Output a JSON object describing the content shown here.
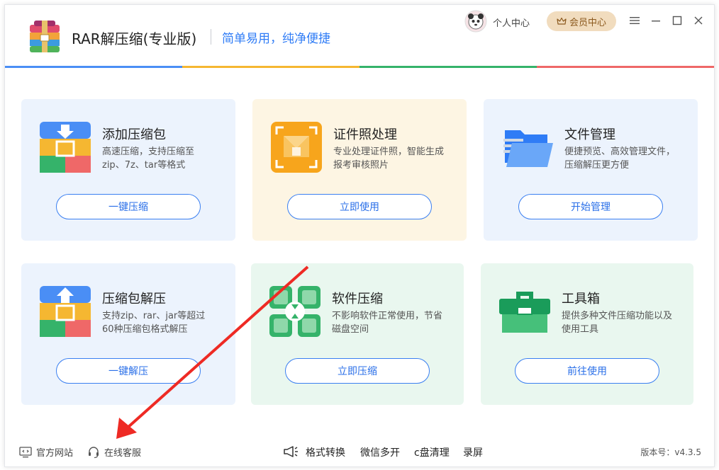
{
  "header": {
    "app_title": "RAR解压缩(专业版)",
    "slogan": "简单易用，纯净便捷",
    "user_center": "个人中心",
    "vip_center": "会员中心"
  },
  "colors": {
    "brand_blue": "#2f7cf6",
    "bar": [
      "#4a8ef5",
      "#f5b731",
      "#35b36a",
      "#ef6868"
    ]
  },
  "cards": [
    {
      "title": "添加压缩包",
      "desc": "高速压缩，支持压缩至zip、7z、tar等格式",
      "button": "一键压缩",
      "icon": "add-archive-icon"
    },
    {
      "title": "证件照处理",
      "desc": "专业处理证件照，智能生成报考审核照片",
      "button": "立即使用",
      "icon": "id-photo-icon"
    },
    {
      "title": "文件管理",
      "desc": "便捷预览、高效管理文件，压缩解压更方便",
      "button": "开始管理",
      "icon": "folder-icon"
    },
    {
      "title": "压缩包解压",
      "desc": "支持zip、rar、jar等超过60种压缩包格式解压",
      "button": "一键解压",
      "icon": "extract-archive-icon"
    },
    {
      "title": "软件压缩",
      "desc": "不影响软件正常使用，节省磁盘空间",
      "button": "立即压缩",
      "icon": "software-compress-icon"
    },
    {
      "title": "工具箱",
      "desc": "提供多种文件压缩功能以及使用工具",
      "button": "前往使用",
      "icon": "toolbox-icon"
    }
  ],
  "footer": {
    "website": "官方网站",
    "support": "在线客服",
    "tools": [
      "格式转换",
      "微信多开",
      "c盘清理",
      "录屏"
    ],
    "version": "版本号：v4.3.5"
  }
}
